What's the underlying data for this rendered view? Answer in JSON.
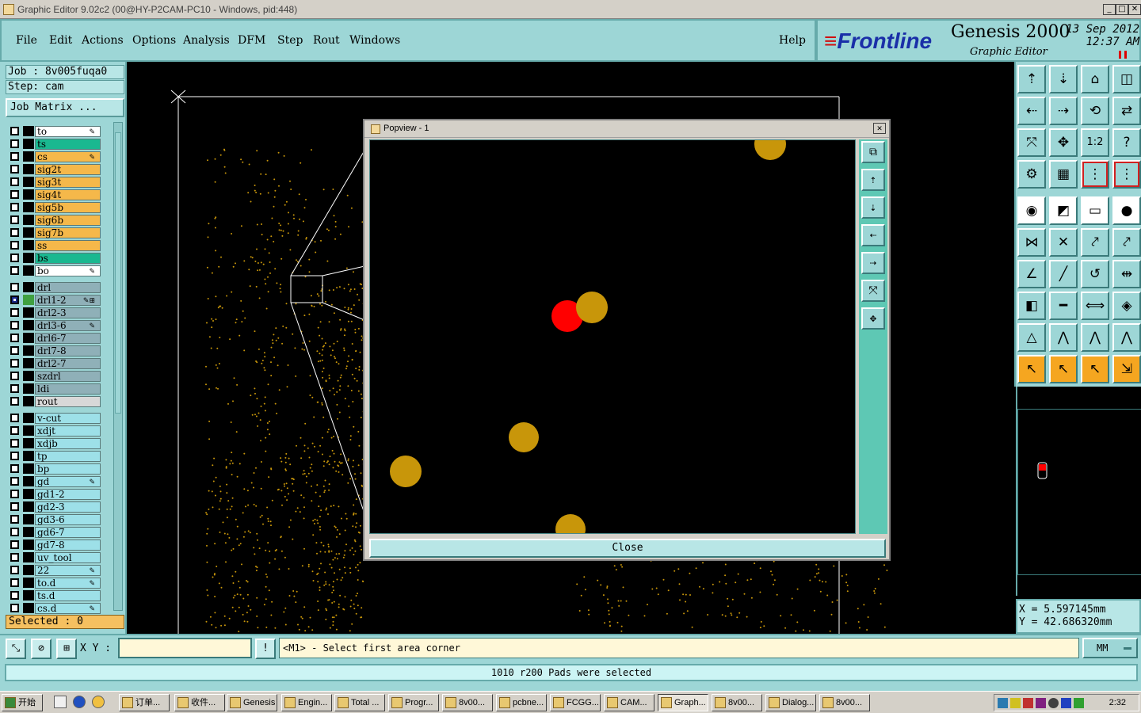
{
  "window": {
    "title": "Graphic Editor 9.02c2 (00@HY-P2CAM-PC10 - Windows, pid:448)",
    "minimize": "_",
    "maximize": "□",
    "close": "✕"
  },
  "menu": {
    "items": [
      "File",
      "Edit",
      "Actions",
      "Options",
      "Analysis",
      "DFM",
      "Step",
      "Rout",
      "Windows"
    ],
    "help": "Help"
  },
  "brand": {
    "logo": "Frontline",
    "product": "Genesis 2000",
    "subtitle": "Graphic Editor",
    "date_line1": "13 Sep 2012",
    "date_line2": "12:37 AM"
  },
  "job": {
    "job_label": "Job : 8v005fuqa0",
    "step_label": "Step: cam",
    "job_matrix_button": "Job Matrix ..."
  },
  "layers": [
    {
      "name": "to",
      "color": "#ffffff",
      "mark": "✎"
    },
    {
      "name": "ts",
      "color": "#1ab890",
      "mark": ""
    },
    {
      "name": "cs",
      "color": "#f5b84a",
      "mark": "✎"
    },
    {
      "name": "sig2t",
      "color": "#f5b84a",
      "mark": ""
    },
    {
      "name": "sig3t",
      "color": "#f5b84a",
      "mark": ""
    },
    {
      "name": "sig4t",
      "color": "#f5b84a",
      "mark": ""
    },
    {
      "name": "sig5b",
      "color": "#f5b84a",
      "mark": ""
    },
    {
      "name": "sig6b",
      "color": "#f5b84a",
      "mark": ""
    },
    {
      "name": "sig7b",
      "color": "#f5b84a",
      "mark": ""
    },
    {
      "name": "ss",
      "color": "#f5b84a",
      "mark": ""
    },
    {
      "name": "bs",
      "color": "#1ab890",
      "mark": ""
    },
    {
      "name": "bo",
      "color": "#ffffff",
      "mark": "✎"
    },
    {
      "name": "drl",
      "color": "#8fb0b8",
      "mark": ""
    },
    {
      "name": "drl1-2",
      "color": "#8fb0b8",
      "mark": "✎⊞",
      "active": true
    },
    {
      "name": "drl2-3",
      "color": "#8fb0b8",
      "mark": ""
    },
    {
      "name": "drl3-6",
      "color": "#8fb0b8",
      "mark": "✎"
    },
    {
      "name": "drl6-7",
      "color": "#8fb0b8",
      "mark": ""
    },
    {
      "name": "drl7-8",
      "color": "#8fb0b8",
      "mark": ""
    },
    {
      "name": "drl2-7",
      "color": "#8fb0b8",
      "mark": ""
    },
    {
      "name": "szdrl",
      "color": "#8fb0b8",
      "mark": ""
    },
    {
      "name": "ldi",
      "color": "#8fb0b8",
      "mark": ""
    },
    {
      "name": "rout",
      "color": "#d8d8d8",
      "mark": ""
    },
    {
      "name": "v-cut",
      "color": "#9de0e8",
      "mark": ""
    },
    {
      "name": "xdjt",
      "color": "#9de0e8",
      "mark": ""
    },
    {
      "name": "xdjb",
      "color": "#9de0e8",
      "mark": ""
    },
    {
      "name": "tp",
      "color": "#9de0e8",
      "mark": ""
    },
    {
      "name": "bp",
      "color": "#9de0e8",
      "mark": ""
    },
    {
      "name": "gd",
      "color": "#9de0e8",
      "mark": "✎"
    },
    {
      "name": "gd1-2",
      "color": "#9de0e8",
      "mark": ""
    },
    {
      "name": "gd2-3",
      "color": "#9de0e8",
      "mark": ""
    },
    {
      "name": "gd3-6",
      "color": "#9de0e8",
      "mark": ""
    },
    {
      "name": "gd6-7",
      "color": "#9de0e8",
      "mark": ""
    },
    {
      "name": "gd7-8",
      "color": "#9de0e8",
      "mark": ""
    },
    {
      "name": "uv_tool",
      "color": "#9de0e8",
      "mark": ""
    },
    {
      "name": "22",
      "color": "#9de0e8",
      "mark": "✎"
    },
    {
      "name": "to.d",
      "color": "#9de0e8",
      "mark": "✎"
    },
    {
      "name": "ts.d",
      "color": "#9de0e8",
      "mark": ""
    },
    {
      "name": "cs.d",
      "color": "#9de0e8",
      "mark": "✎"
    }
  ],
  "selected_label": "Selected : 0",
  "popview": {
    "title": "Popview - 1",
    "close_button": "Close",
    "tools": [
      "zoom-window-icon",
      "zoom-up-icon",
      "zoom-down-icon",
      "pan-left-icon",
      "pan-right-icon",
      "fit-all-icon",
      "center-icon"
    ]
  },
  "right_tools": [
    {
      "name": "zoom-in-icon",
      "glyph": "⇡"
    },
    {
      "name": "zoom-out-icon",
      "glyph": "⇣"
    },
    {
      "name": "home-icon",
      "glyph": "⌂"
    },
    {
      "name": "zoom-window-icon",
      "glyph": "◫"
    },
    {
      "name": "pan-left-icon",
      "glyph": "⇠"
    },
    {
      "name": "pan-right-icon",
      "glyph": "⇢"
    },
    {
      "name": "redraw-icon",
      "glyph": "⟲"
    },
    {
      "name": "swap-icon",
      "glyph": "⇄"
    },
    {
      "name": "fit-icon",
      "glyph": "⤧"
    },
    {
      "name": "center-icon",
      "glyph": "✥"
    },
    {
      "name": "scale-icon",
      "glyph": "1:2"
    },
    {
      "name": "query-icon",
      "glyph": "?"
    },
    {
      "name": "tools-icon",
      "glyph": "⚙"
    },
    {
      "name": "grid-icon",
      "glyph": "▦"
    },
    {
      "name": "snap-icon",
      "glyph": "⋮"
    },
    {
      "name": "snap-alt-icon",
      "glyph": "⋮"
    },
    {
      "name": "measure-point-icon",
      "glyph": "◉"
    },
    {
      "name": "color-icon",
      "glyph": "◩"
    },
    {
      "name": "ruler-icon",
      "glyph": "▭"
    },
    {
      "name": "pad-icon",
      "glyph": "●"
    },
    {
      "name": "connect-icon",
      "glyph": "⋈"
    },
    {
      "name": "cross-icon",
      "glyph": "✕"
    },
    {
      "name": "point-to-point-icon",
      "glyph": "⤤"
    },
    {
      "name": "line-point-icon",
      "glyph": "⤤"
    },
    {
      "name": "angle-icon",
      "glyph": "∠"
    },
    {
      "name": "line-icon",
      "glyph": "╱"
    },
    {
      "name": "arc-icon",
      "glyph": "↺"
    },
    {
      "name": "mirror-icon",
      "glyph": "⇹"
    },
    {
      "name": "pad-distance-icon",
      "glyph": "◧"
    },
    {
      "name": "line-distance-icon",
      "glyph": "━"
    },
    {
      "name": "width-icon",
      "glyph": "⟺"
    },
    {
      "name": "shapes-icon",
      "glyph": "◈"
    },
    {
      "name": "triangle-icon",
      "glyph": "△"
    },
    {
      "name": "peak-icon",
      "glyph": "⋀"
    },
    {
      "name": "peak-alt-icon",
      "glyph": "⋀"
    },
    {
      "name": "peak-blue-icon",
      "glyph": "⋀"
    },
    {
      "name": "select-icon",
      "glyph": "↖"
    },
    {
      "name": "select-box-icon",
      "glyph": "↖"
    },
    {
      "name": "select-polygon-icon",
      "glyph": "↖"
    },
    {
      "name": "select-net-icon",
      "glyph": "⇲"
    }
  ],
  "coords": {
    "x": "X = 5.597145mm",
    "y": "Y = 42.686320mm"
  },
  "command": {
    "xy_label": "X Y :",
    "xy_value": "",
    "prompt": "<M1> - Select first area corner",
    "units": "MM",
    "tool1": "⤡",
    "tool2": "⊘",
    "tool3": "⊞",
    "tool4": "!"
  },
  "status": {
    "message": "1010 r200 Pads were selected"
  },
  "taskbar": {
    "start": "开始",
    "buttons": [
      "订单...",
      "收件...",
      "Genesis",
      "Engin...",
      "Total ...",
      "Progr...",
      "8v00...",
      "pcbne...",
      "FCGG...",
      "CAM...",
      "Graph...",
      "8v00...",
      "Dialog...",
      "8v00..."
    ],
    "clock": "2:32"
  },
  "colors": {
    "panel": "#9dd6d6",
    "pad": "#c8960a",
    "highlight_pad": "#ff0000",
    "accent_green": "#5ec8b4"
  }
}
